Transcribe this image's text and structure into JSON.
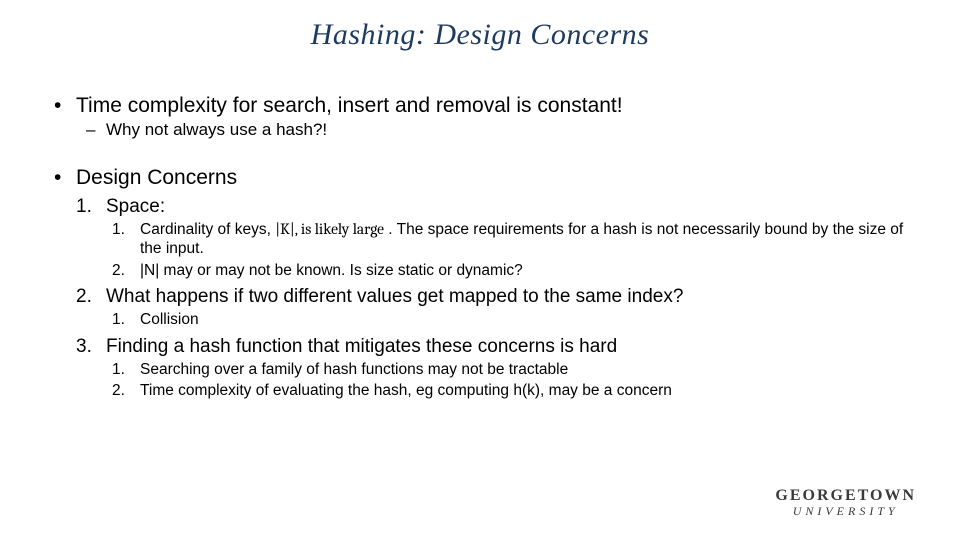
{
  "title": "Hashing: Design Concerns",
  "bullets": {
    "b1": "Time complexity for search, insert and removal is constant!",
    "b1_sub1": "Why not always use a hash?!",
    "b2": "Design Concerns",
    "n1": "Space:",
    "n1_a_pre": "Cardinality of keys, ",
    "n1_a_mid": "|K|, is likely large",
    "n1_a_post": " . The space requirements for a hash is not necessarily bound by the size of the input.",
    "n1_b": "|N| may or may not be known. Is size static or dynamic?",
    "n2": "What happens if two different values get mapped to the same index?",
    "n2_a": "Collision",
    "n3": "Finding a hash function that mitigates these concerns is hard",
    "n3_a": "Searching over a family of hash functions may not be tractable",
    "n3_b": "Time complexity of evaluating the hash, eg computing h(k), may be a concern"
  },
  "numbers": {
    "one": "1.",
    "two": "2.",
    "three": "3."
  },
  "logo": {
    "line1": "GEORGETOWN",
    "line2": "UNIVERSITY"
  }
}
